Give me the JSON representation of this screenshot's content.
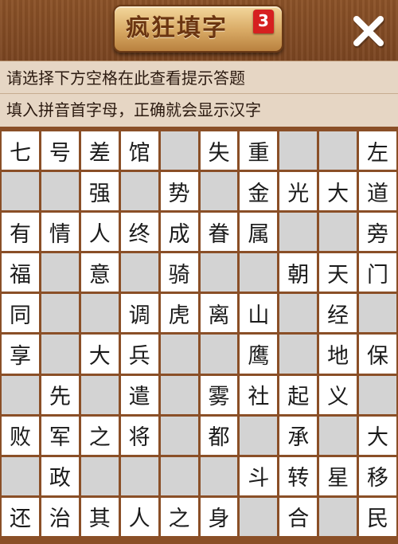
{
  "header": {
    "title": "疯狂填字",
    "level": "3",
    "close_icon": "close-icon"
  },
  "hints": {
    "line1": "请选择下方空格在此查看提示答题",
    "line2": "填入拼音首字母，正确就会显示汉字"
  },
  "colors": {
    "wood": "#8a4f27",
    "hint_bg": "#e6d6c4",
    "cell_white": "#ffffff",
    "cell_gray": "#d3d3d3",
    "badge_red": "#d62020"
  },
  "grid": {
    "rows": [
      [
        "七",
        "号",
        "差",
        "馆",
        "",
        "失",
        "重",
        "",
        "",
        "左"
      ],
      [
        "",
        "",
        "强",
        "",
        "势",
        "",
        "金",
        "光",
        "大",
        "道"
      ],
      [
        "有",
        "情",
        "人",
        "终",
        "成",
        "眷",
        "属",
        "",
        "",
        "旁"
      ],
      [
        "福",
        "",
        "意",
        "",
        "骑",
        "",
        "",
        "朝",
        "天",
        "门"
      ],
      [
        "同",
        "",
        "",
        "调",
        "虎",
        "离",
        "山",
        "",
        "经",
        ""
      ],
      [
        "享",
        "",
        "大",
        "兵",
        "",
        "",
        "鹰",
        "",
        "地",
        "保"
      ],
      [
        "",
        "先",
        "",
        "遣",
        "",
        "雾",
        "社",
        "起",
        "义",
        ""
      ],
      [
        "败",
        "军",
        "之",
        "将",
        "",
        "都",
        "",
        "承",
        "",
        "大"
      ],
      [
        "",
        "政",
        "",
        "",
        "",
        "",
        "斗",
        "转",
        "星",
        "移"
      ],
      [
        "还",
        "治",
        "其",
        "人",
        "之",
        "身",
        "",
        "合",
        "",
        "民"
      ]
    ],
    "white_mask": [
      [
        1,
        1,
        1,
        1,
        0,
        1,
        1,
        0,
        0,
        1
      ],
      [
        0,
        0,
        1,
        0,
        1,
        0,
        1,
        1,
        1,
        1
      ],
      [
        1,
        1,
        1,
        1,
        1,
        1,
        1,
        0,
        0,
        1
      ],
      [
        1,
        0,
        1,
        0,
        1,
        0,
        0,
        1,
        1,
        1
      ],
      [
        1,
        0,
        0,
        1,
        1,
        1,
        1,
        0,
        1,
        0
      ],
      [
        1,
        0,
        1,
        1,
        0,
        0,
        1,
        0,
        1,
        1
      ],
      [
        0,
        1,
        0,
        1,
        0,
        1,
        1,
        1,
        1,
        0
      ],
      [
        1,
        1,
        1,
        1,
        0,
        1,
        0,
        1,
        0,
        1
      ],
      [
        0,
        1,
        0,
        0,
        0,
        0,
        1,
        1,
        1,
        1
      ],
      [
        1,
        1,
        1,
        1,
        1,
        1,
        0,
        1,
        0,
        1
      ]
    ]
  }
}
